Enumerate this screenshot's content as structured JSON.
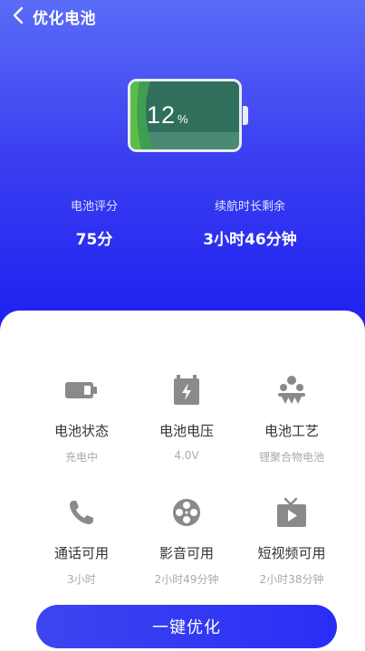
{
  "header": {
    "title": "优化电池",
    "back_icon": "chevron-left-icon"
  },
  "battery": {
    "level": "12",
    "unit": "%",
    "fill_fraction": 0.12,
    "colors": {
      "fill_light": "#5cbd4a",
      "fill_dark": "#2f6f5c",
      "frame": "#e8ecf5"
    }
  },
  "stats": {
    "score_label": "电池评分",
    "score_value": "75分",
    "remain_label": "续航时长剩余",
    "remain_value": "3小时46分钟"
  },
  "grid": [
    {
      "title": "电池状态",
      "sub": "充电中",
      "icon": "battery-icon"
    },
    {
      "title": "电池电压",
      "sub": "4.0V",
      "icon": "voltage-icon"
    },
    {
      "title": "电池工艺",
      "sub": "锂聚合物电池",
      "icon": "molecule-icon"
    },
    {
      "title": "通话可用",
      "sub": "3小时",
      "icon": "phone-icon"
    },
    {
      "title": "影音可用",
      "sub": "2小时49分钟",
      "icon": "film-reel-icon"
    },
    {
      "title": "短视频可用",
      "sub": "2小时38分钟",
      "icon": "tv-play-icon"
    }
  ],
  "action": {
    "optimize_label": "一键优化"
  },
  "theme": {
    "accent": "#2a2ef5",
    "icon_gray": "#8a8a8a"
  }
}
